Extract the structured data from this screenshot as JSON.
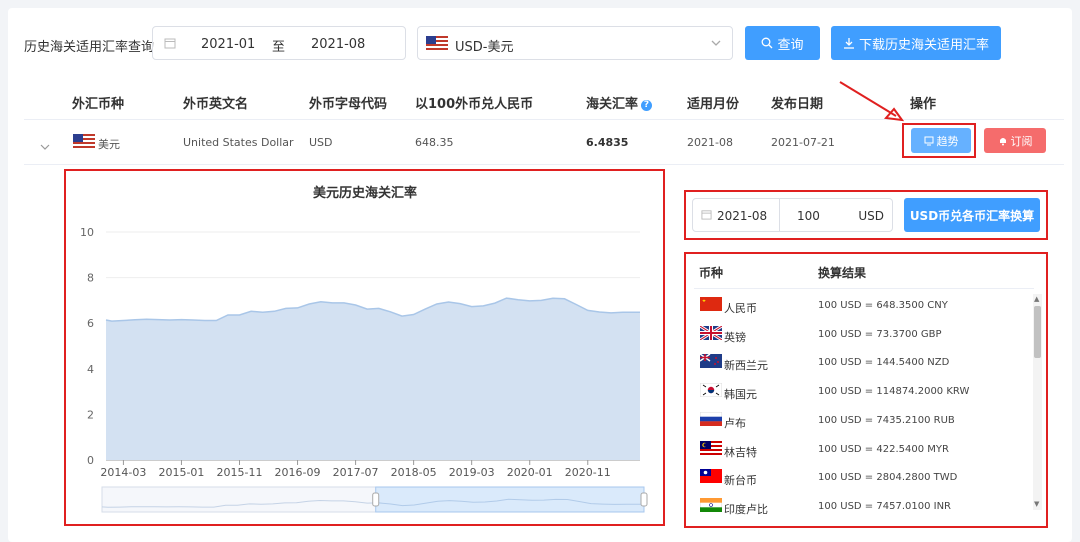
{
  "query": {
    "label": "历史海关适用汇率查询",
    "start_month": "2021-01",
    "to_label": "至",
    "end_month": "2021-08",
    "currency_select": "USD-美元",
    "query_button": "查询",
    "download_button": "下载历史海关适用汇率"
  },
  "table": {
    "headers": [
      "外汇币种",
      "外币英文名",
      "外币字母代码",
      "以100外币兑人民币",
      "海关汇率",
      "适用月份",
      "发布日期",
      "操作"
    ],
    "row": {
      "currency": "美元",
      "english_name": "United States Dollar",
      "code": "USD",
      "per100": "648.35",
      "rate": "6.4835",
      "month": "2021-08",
      "published": "2021-07-21"
    },
    "trend_button": "趋势",
    "subscribe_button": "订阅"
  },
  "converter": {
    "date": "2021-08",
    "amount": "100",
    "currency": "USD",
    "button": "USD币兑各币汇率换算",
    "col_currency": "币种",
    "col_result": "换算结果",
    "results": [
      {
        "flag": "cn",
        "name": "人民币",
        "value": "100 USD = 648.3500 CNY"
      },
      {
        "flag": "gb",
        "name": "英镑",
        "value": "100 USD = 73.3700 GBP"
      },
      {
        "flag": "nz",
        "name": "新西兰元",
        "value": "100 USD = 144.5400 NZD"
      },
      {
        "flag": "kr",
        "name": "韩国元",
        "value": "100 USD = 114874.2000 KRW"
      },
      {
        "flag": "ru",
        "name": "卢布",
        "value": "100 USD = 7435.2100 RUB"
      },
      {
        "flag": "my",
        "name": "林吉特",
        "value": "100 USD = 422.5400 MYR"
      },
      {
        "flag": "tw",
        "name": "新台币",
        "value": "100 USD = 2804.2800 TWD"
      },
      {
        "flag": "in",
        "name": "印度卢比",
        "value": "100 USD = 7457.0100 INR"
      }
    ]
  },
  "colors": {
    "primary": "#409eff",
    "danger": "#f56c6c",
    "highlight": "#e02020",
    "area_fill": "#d3e1f2",
    "area_line": "#a9c6e8"
  },
  "chart_data": {
    "type": "area",
    "title": "美元历史海关汇率",
    "ylim": [
      0,
      10
    ],
    "yticks": [
      0,
      2,
      4,
      6,
      8,
      10
    ],
    "x_ticks": [
      "2014-03",
      "2015-01",
      "2015-11",
      "2016-09",
      "2017-07",
      "2018-05",
      "2019-03",
      "2020-01",
      "2020-11"
    ],
    "grid": true,
    "x": [
      "2013-12",
      "2014-01",
      "2014-03",
      "2014-05",
      "2014-07",
      "2014-09",
      "2014-11",
      "2015-01",
      "2015-03",
      "2015-05",
      "2015-07",
      "2015-09",
      "2015-11",
      "2016-01",
      "2016-03",
      "2016-05",
      "2016-07",
      "2016-09",
      "2016-11",
      "2017-01",
      "2017-03",
      "2017-05",
      "2017-07",
      "2017-09",
      "2017-11",
      "2018-01",
      "2018-03",
      "2018-05",
      "2018-07",
      "2018-09",
      "2018-11",
      "2019-01",
      "2019-03",
      "2019-05",
      "2019-07",
      "2019-09",
      "2019-11",
      "2020-01",
      "2020-03",
      "2020-05",
      "2020-07",
      "2020-09",
      "2020-11",
      "2021-01",
      "2021-03",
      "2021-05",
      "2021-08"
    ],
    "values": [
      6.14,
      6.09,
      6.12,
      6.15,
      6.17,
      6.16,
      6.14,
      6.16,
      6.14,
      6.12,
      6.12,
      6.36,
      6.36,
      6.52,
      6.48,
      6.52,
      6.65,
      6.67,
      6.84,
      6.94,
      6.89,
      6.89,
      6.8,
      6.62,
      6.65,
      6.5,
      6.31,
      6.38,
      6.62,
      6.84,
      6.93,
      6.86,
      6.73,
      6.76,
      6.88,
      7.1,
      7.03,
      6.98,
      7.0,
      7.09,
      7.07,
      6.82,
      6.56,
      6.49,
      6.45,
      6.48,
      6.48
    ]
  }
}
